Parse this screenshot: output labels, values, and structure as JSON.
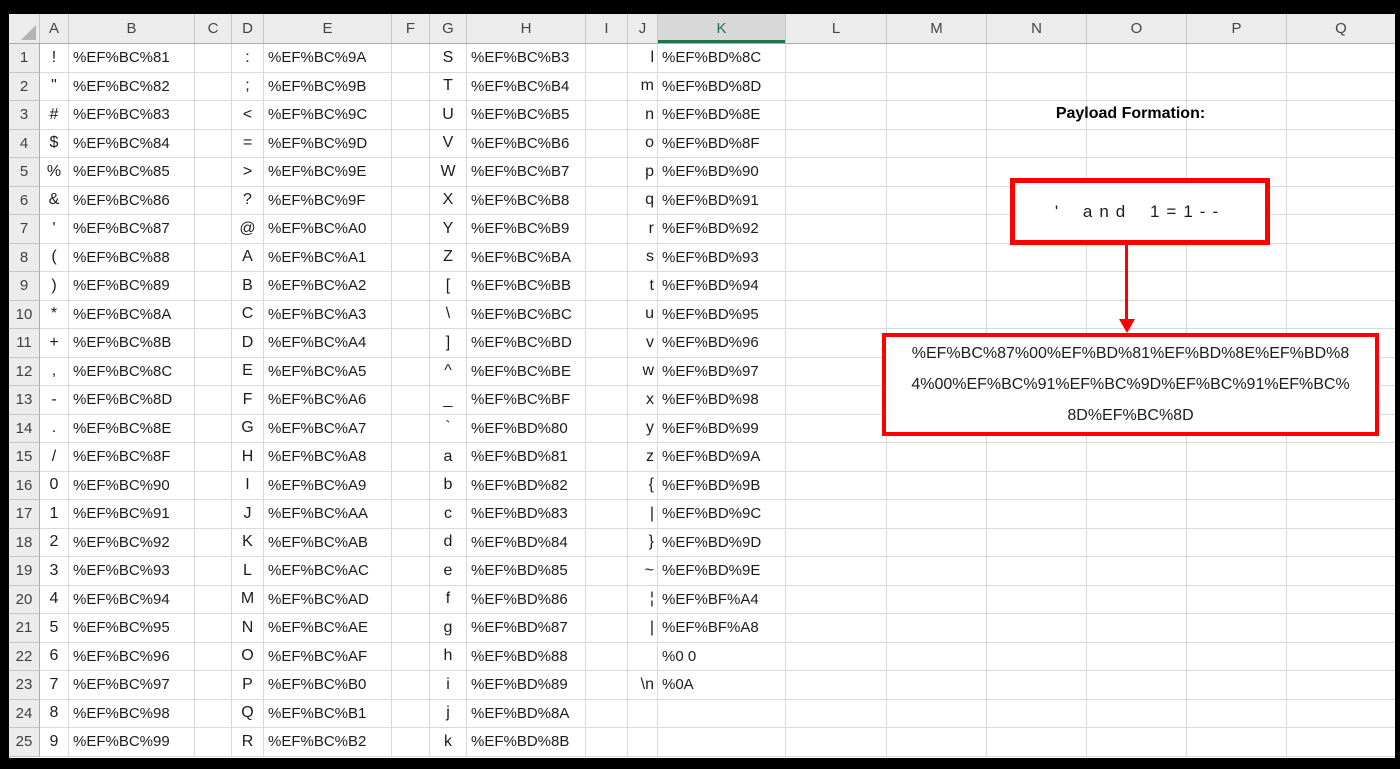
{
  "sheet": {
    "column_headers": [
      "A",
      "B",
      "C",
      "D",
      "E",
      "F",
      "G",
      "H",
      "I",
      "J",
      "K",
      "L",
      "M",
      "N",
      "O",
      "P",
      "Q"
    ],
    "selected_column": "K",
    "rows": [
      {
        "n": "1",
        "a": "!",
        "b": "%EF%BC%81",
        "d": ":",
        "e": "%EF%BC%9A",
        "g": "S",
        "h": "%EF%BC%B3",
        "j": "l",
        "k": "%EF%BD%8C"
      },
      {
        "n": "2",
        "a": "\"",
        "b": "%EF%BC%82",
        "d": ";",
        "e": "%EF%BC%9B",
        "g": "T",
        "h": "%EF%BC%B4",
        "j": "m",
        "k": "%EF%BD%8D"
      },
      {
        "n": "3",
        "a": "#",
        "b": "%EF%BC%83",
        "d": "<",
        "e": "%EF%BC%9C",
        "g": "U",
        "h": "%EF%BC%B5",
        "j": "n",
        "k": "%EF%BD%8E"
      },
      {
        "n": "4",
        "a": "$",
        "b": "%EF%BC%84",
        "d": "=",
        "e": "%EF%BC%9D",
        "g": "V",
        "h": "%EF%BC%B6",
        "j": "o",
        "k": "%EF%BD%8F"
      },
      {
        "n": "5",
        "a": "%",
        "b": "%EF%BC%85",
        "d": ">",
        "e": "%EF%BC%9E",
        "g": "W",
        "h": "%EF%BC%B7",
        "j": "p",
        "k": "%EF%BD%90"
      },
      {
        "n": "6",
        "a": "&",
        "b": "%EF%BC%86",
        "d": "?",
        "e": "%EF%BC%9F",
        "g": "X",
        "h": "%EF%BC%B8",
        "j": "q",
        "k": "%EF%BD%91"
      },
      {
        "n": "7",
        "a": "'",
        "b": "%EF%BC%87",
        "d": "@",
        "e": "%EF%BC%A0",
        "g": "Y",
        "h": "%EF%BC%B9",
        "j": "r",
        "k": "%EF%BD%92"
      },
      {
        "n": "8",
        "a": "(",
        "b": "%EF%BC%88",
        "d": "A",
        "e": "%EF%BC%A1",
        "g": "Z",
        "h": "%EF%BC%BA",
        "j": "s",
        "k": "%EF%BD%93"
      },
      {
        "n": "9",
        "a": ")",
        "b": "%EF%BC%89",
        "d": "B",
        "e": "%EF%BC%A2",
        "g": "[",
        "h": "%EF%BC%BB",
        "j": "t",
        "k": "%EF%BD%94"
      },
      {
        "n": "10",
        "a": "*",
        "b": "%EF%BC%8A",
        "d": "C",
        "e": "%EF%BC%A3",
        "g": "\\",
        "h": "%EF%BC%BC",
        "j": "u",
        "k": "%EF%BD%95"
      },
      {
        "n": "11",
        "a": "+",
        "b": "%EF%BC%8B",
        "d": "D",
        "e": "%EF%BC%A4",
        "g": "]",
        "h": "%EF%BC%BD",
        "j": "v",
        "k": "%EF%BD%96"
      },
      {
        "n": "12",
        "a": ",",
        "b": "%EF%BC%8C",
        "d": "E",
        "e": "%EF%BC%A5",
        "g": "^",
        "h": "%EF%BC%BE",
        "j": "w",
        "k": "%EF%BD%97"
      },
      {
        "n": "13",
        "a": "-",
        "b": "%EF%BC%8D",
        "d": "F",
        "e": "%EF%BC%A6",
        "g": "_",
        "h": "%EF%BC%BF",
        "j": "x",
        "k": "%EF%BD%98"
      },
      {
        "n": "14",
        "a": ".",
        "b": "%EF%BC%8E",
        "d": "G",
        "e": "%EF%BC%A7",
        "g": "`",
        "h": "%EF%BD%80",
        "j": "y",
        "k": "%EF%BD%99"
      },
      {
        "n": "15",
        "a": "/",
        "b": "%EF%BC%8F",
        "d": "H",
        "e": "%EF%BC%A8",
        "g": "a",
        "h": "%EF%BD%81",
        "j": "z",
        "k": "%EF%BD%9A"
      },
      {
        "n": "16",
        "a": "0",
        "b": "%EF%BC%90",
        "d": "I",
        "e": "%EF%BC%A9",
        "g": "b",
        "h": "%EF%BD%82",
        "j": "{",
        "k": "%EF%BD%9B"
      },
      {
        "n": "17",
        "a": "1",
        "b": "%EF%BC%91",
        "d": "J",
        "e": "%EF%BC%AA",
        "g": "c",
        "h": "%EF%BD%83",
        "j": "|",
        "k": "%EF%BD%9C"
      },
      {
        "n": "18",
        "a": "2",
        "b": "%EF%BC%92",
        "d": "K",
        "e": "%EF%BC%AB",
        "g": "d",
        "h": "%EF%BD%84",
        "j": "}",
        "k": "%EF%BD%9D"
      },
      {
        "n": "19",
        "a": "3",
        "b": "%EF%BC%93",
        "d": "L",
        "e": "%EF%BC%AC",
        "g": "e",
        "h": "%EF%BD%85",
        "j": "~",
        "k": "%EF%BD%9E"
      },
      {
        "n": "20",
        "a": "4",
        "b": "%EF%BC%94",
        "d": "M",
        "e": "%EF%BC%AD",
        "g": "f",
        "h": "%EF%BD%86",
        "j": "¦",
        "k": "%EF%BF%A4"
      },
      {
        "n": "21",
        "a": "5",
        "b": "%EF%BC%95",
        "d": "N",
        "e": "%EF%BC%AE",
        "g": "g",
        "h": "%EF%BD%87",
        "j": "|",
        "k": "%EF%BF%A8"
      },
      {
        "n": "22",
        "a": "6",
        "b": "%EF%BC%96",
        "d": "O",
        "e": "%EF%BC%AF",
        "g": "h",
        "h": "%EF%BD%88",
        "j": "",
        "k": "%0 0"
      },
      {
        "n": "23",
        "a": "7",
        "b": "%EF%BC%97",
        "d": "P",
        "e": "%EF%BC%B0",
        "g": "i",
        "h": "%EF%BD%89",
        "j": "\\n",
        "k": "%0A"
      },
      {
        "n": "24",
        "a": "8",
        "b": "%EF%BC%98",
        "d": "Q",
        "e": "%EF%BC%B1",
        "g": "j",
        "h": "%EF%BD%8A",
        "j": "",
        "k": ""
      },
      {
        "n": "25",
        "a": "9",
        "b": "%EF%BC%99",
        "d": "R",
        "e": "%EF%BC%B2",
        "g": "k",
        "h": "%EF%BD%8B",
        "j": "",
        "k": ""
      }
    ]
  },
  "annotation": {
    "title": "Payload Formation:",
    "payload_plain": "' and 1=1--",
    "payload_encoded": "%EF%BC%87%00%EF%BD%81%EF%BD%8E%EF%BD%84%00%EF%BC%91%EF%BC%9D%EF%BC%91%EF%BC%8D%EF%BC%8D",
    "payload_encoded_lines": [
      "%EF%BC%87%00%EF%BD%81%EF%BD%8E%EF%BD%8",
      "4%00%EF%BC%91%EF%BC%9D%EF%BC%91%EF%BC%",
      "8D%EF%BC%8D"
    ],
    "accent_red": "#FF0000",
    "selection_green": "#217346"
  }
}
